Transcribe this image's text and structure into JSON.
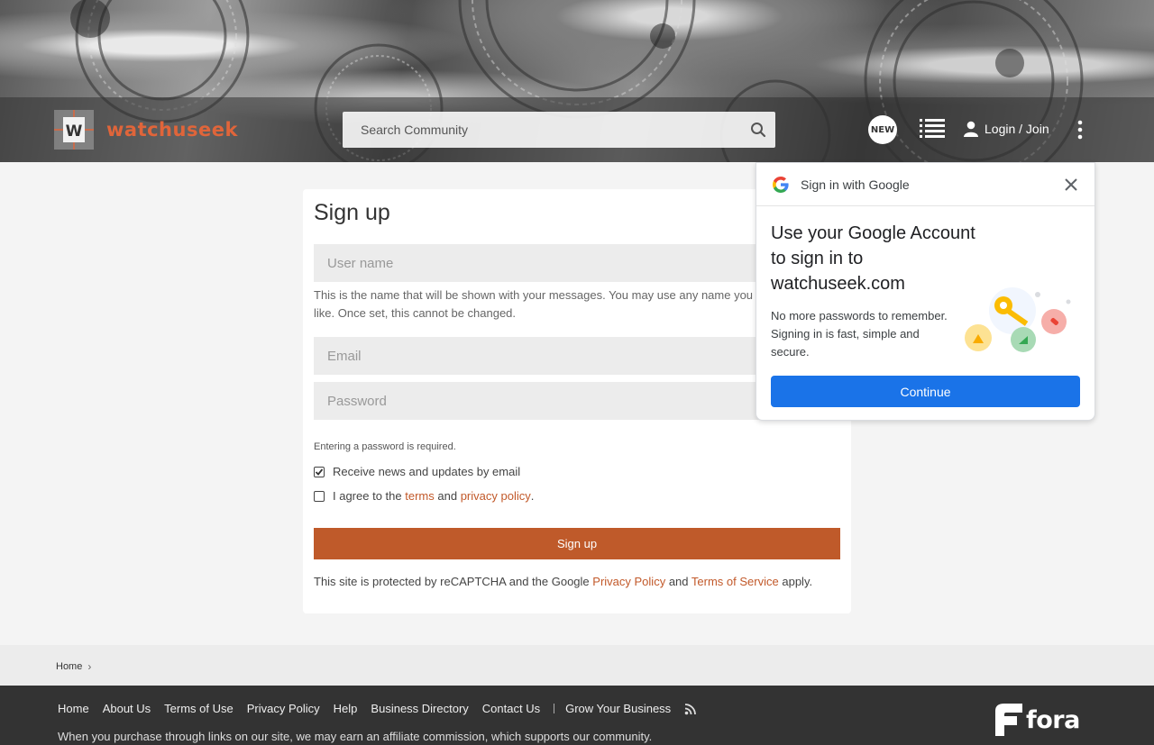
{
  "header": {
    "site_name": "watchuseek",
    "logo_letter": "W",
    "search_placeholder": "Search Community",
    "new_badge": "NEW",
    "login_label": "Login / Join"
  },
  "signup": {
    "title": "Sign up",
    "username_placeholder": "User name",
    "username_help": "This is the name that will be shown with your messages. You may use any name you like. Once set, this cannot be changed.",
    "email_placeholder": "Email",
    "password_placeholder": "Password",
    "password_note": "Entering a password is required.",
    "newsletter_label": "Receive news and updates by email",
    "agree_prefix": "I agree to the",
    "terms_link": "terms",
    "and_word": "and",
    "privacy_link": "privacy policy",
    "agree_suffix": ".",
    "submit_label": "Sign up",
    "recaptcha_prefix": "This site is protected by reCAPTCHA and the Google",
    "recaptcha_privacy": "Privacy Policy",
    "recaptcha_and": "and",
    "recaptcha_terms": "Terms of Service",
    "recaptcha_suffix": "apply."
  },
  "google_popup": {
    "title": "Sign in with Google",
    "heading": "Use your Google Account to sign in to watchuseek.com",
    "body": "No more passwords to remember. Signing in is fast, simple and secure.",
    "continue_label": "Continue"
  },
  "breadcrumb": {
    "home": "Home"
  },
  "footer": {
    "links": [
      "Home",
      "About Us",
      "Terms of Use",
      "Privacy Policy",
      "Help",
      "Business Directory",
      "Contact Us"
    ],
    "grow_label": "Grow Your Business",
    "note": "When you purchase through links on our site, we may earn an affiliate commission, which supports our community.",
    "brand": "fora"
  },
  "colors": {
    "accent": "#bf5a2a",
    "link": "#c2592a",
    "google_blue": "#1a73e8",
    "footer_bg": "#333333"
  }
}
